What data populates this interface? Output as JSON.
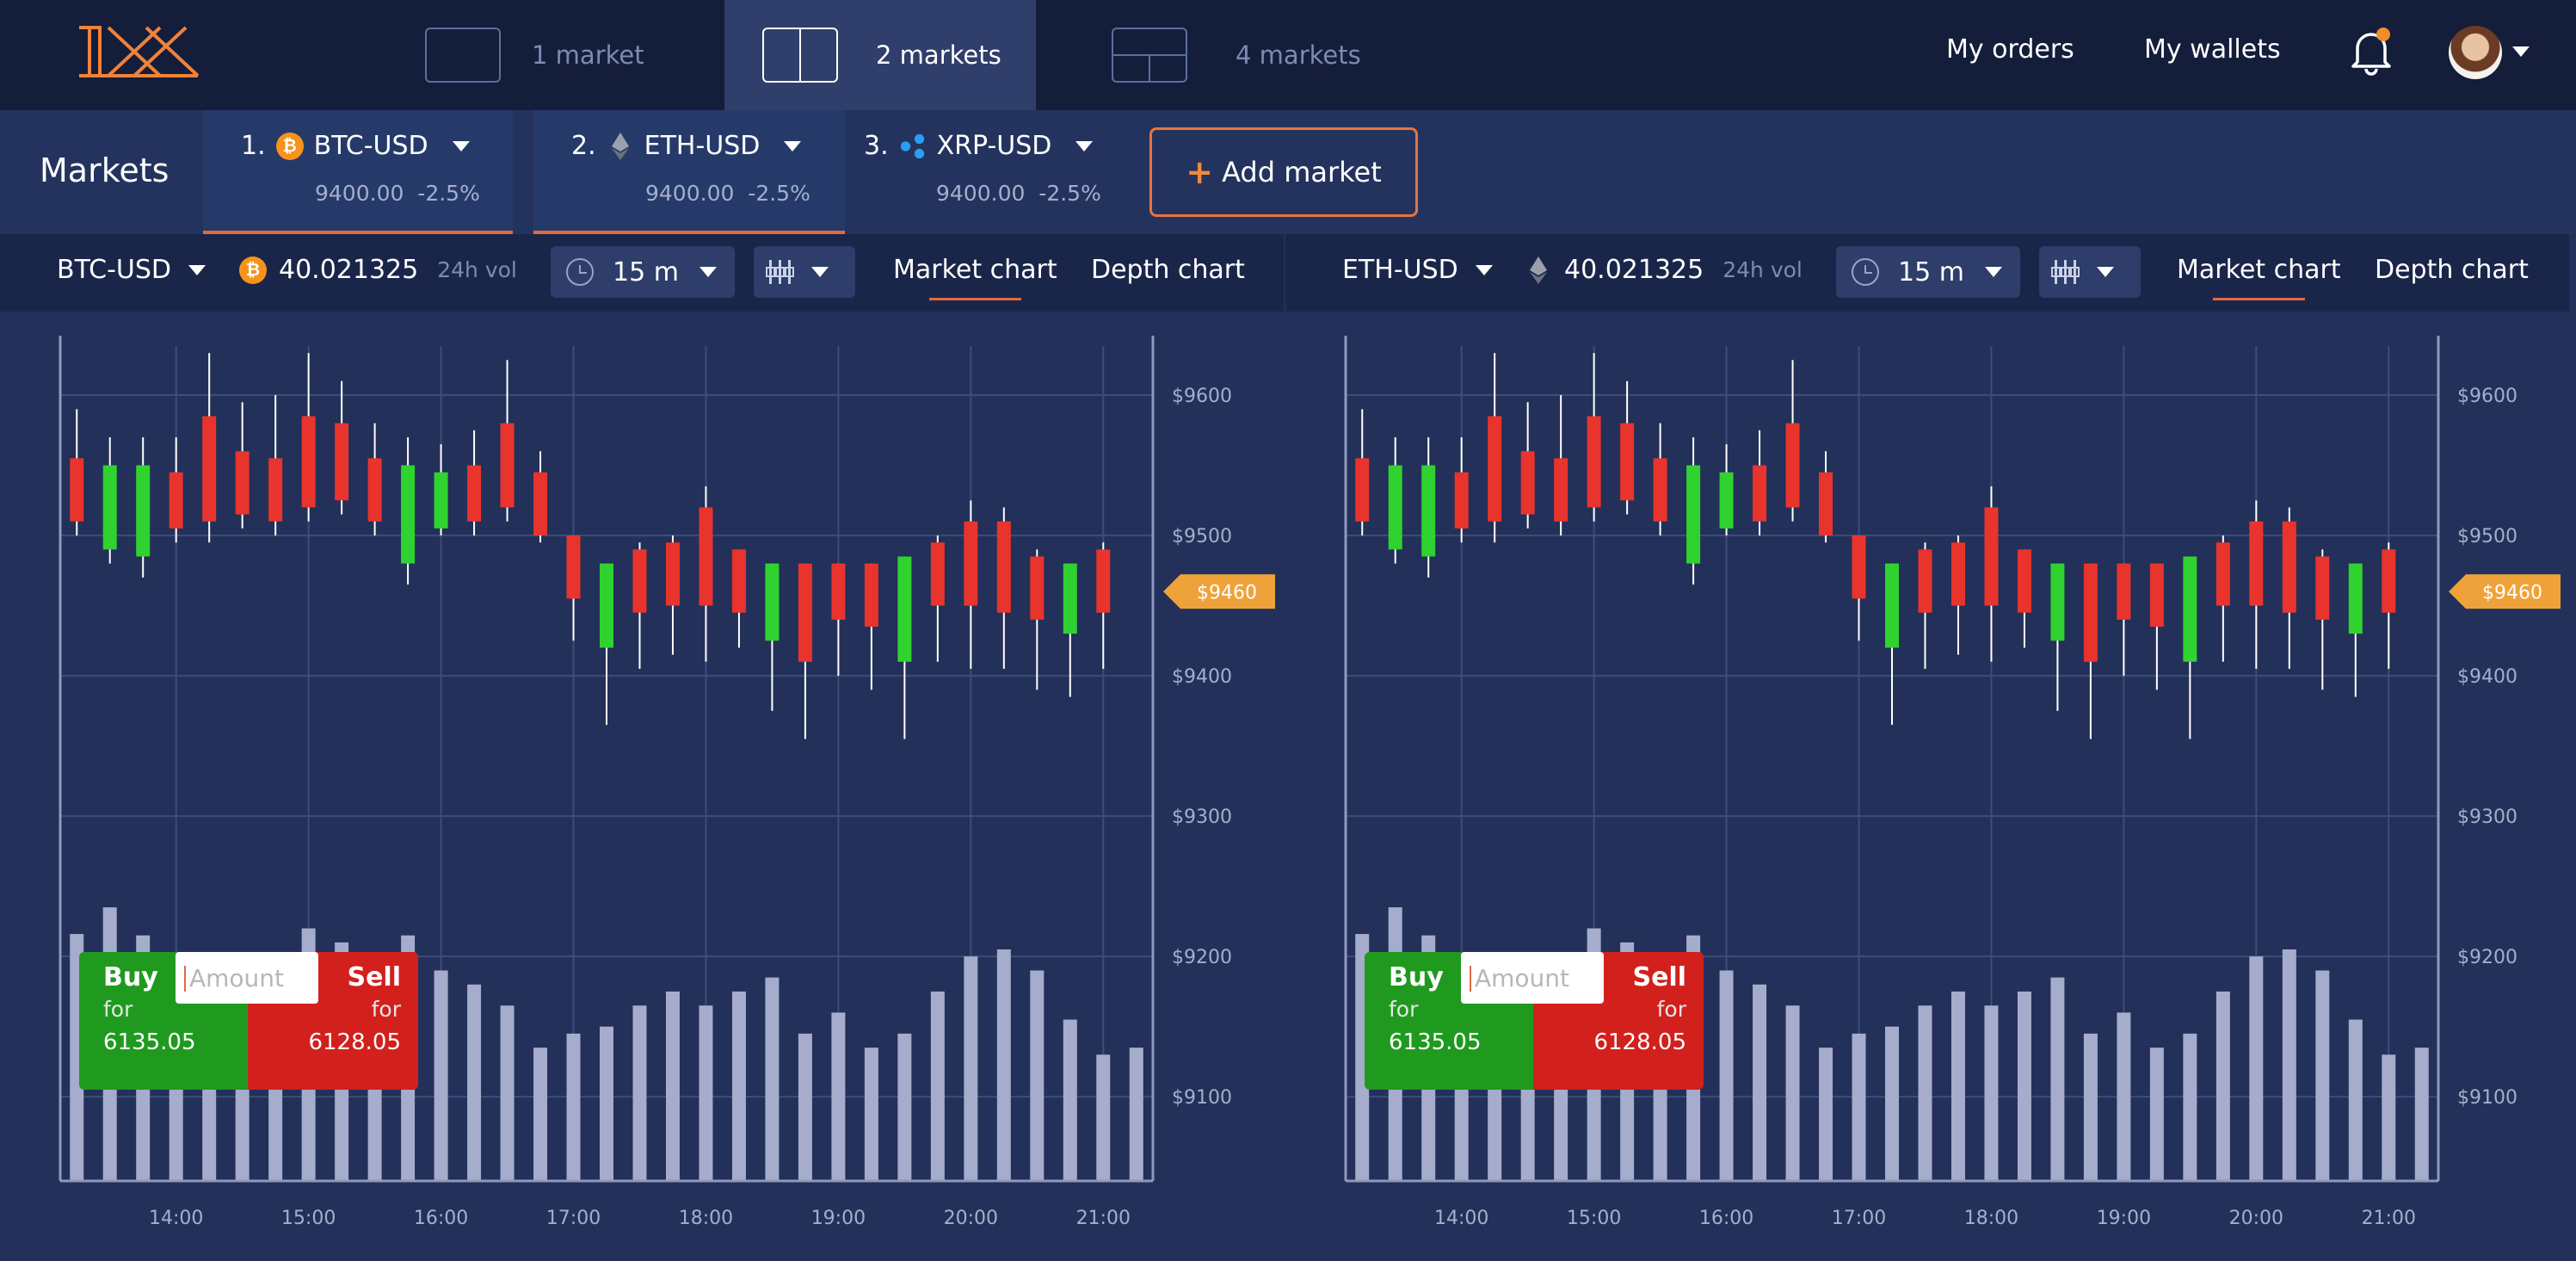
{
  "top_bar": {
    "logo_text": "1X",
    "layout_tabs": [
      {
        "label": "1 market",
        "active": false
      },
      {
        "label": "2 markets",
        "active": true
      },
      {
        "label": "4 markets",
        "active": false
      }
    ],
    "nav": {
      "my_orders": "My orders",
      "my_wallets": "My wallets"
    },
    "bell_icon": "bell-icon",
    "notification_color": "#f28d2c",
    "avatar_icon": "user-avatar"
  },
  "markets_bar": {
    "title": "Markets",
    "tabs": [
      {
        "index": "1.",
        "pair": "BTC-USD",
        "coin_icon": "bitcoin-icon",
        "coin_color": "#f7931a",
        "price": "9400.00",
        "change": "-2.5%",
        "active": true
      },
      {
        "index": "2.",
        "pair": "ETH-USD",
        "coin_icon": "ethereum-icon",
        "coin_color": "#8a8f99",
        "price": "9400.00",
        "change": "-2.5%",
        "active": true
      },
      {
        "index": "3.",
        "pair": "XRP-USD",
        "coin_icon": "ripple-icon",
        "coin_color": "#2a9df4",
        "price": "9400.00",
        "change": "-2.5%",
        "active": false
      }
    ],
    "add_market": {
      "icon": "+",
      "label": "Add market"
    }
  },
  "panels": [
    {
      "pair": "BTC-USD",
      "coin_icon": "bitcoin-icon",
      "coin_color": "#f7931a",
      "volume": "40.021325",
      "volume_unit": "24h vol",
      "interval": "15 m",
      "chart_type_icon": "candlestick-icon",
      "tabs": {
        "market_chart": "Market chart",
        "depth_chart": "Depth chart"
      },
      "trade": {
        "buy": "Buy",
        "sell": "Sell",
        "for": "for",
        "buy_price": "6135.05",
        "sell_price": "6128.05",
        "amount_placeholder": "Amount"
      }
    },
    {
      "pair": "ETH-USD",
      "coin_icon": "ethereum-icon",
      "coin_color": "#8a8f99",
      "volume": "40.021325",
      "volume_unit": "24h vol",
      "interval": "15 m",
      "chart_type_icon": "candlestick-icon",
      "tabs": {
        "market_chart": "Market chart",
        "depth_chart": "Depth chart"
      },
      "trade": {
        "buy": "Buy",
        "sell": "Sell",
        "for": "for",
        "buy_price": "6135.05",
        "sell_price": "6128.05",
        "amount_placeholder": "Amount"
      }
    }
  ],
  "colors": {
    "up": "#2fd22f",
    "down": "#e8342c",
    "price_tag": "#f0a23a",
    "accent": "#e06a40"
  },
  "chart_data": [
    {
      "type": "candlestick",
      "ylim": [
        9040,
        9635
      ],
      "y_ticks": [
        "$9600",
        "$9500",
        "$9400",
        "$9300",
        "$9200",
        "$9100"
      ],
      "y_tick_values": [
        9600,
        9500,
        9400,
        9300,
        9200,
        9100
      ],
      "x_ticks": [
        "14:00",
        "15:00",
        "16:00",
        "17:00",
        "18:00",
        "19:00",
        "20:00",
        "21:00"
      ],
      "x_tick_slots": [
        3,
        7,
        11,
        15,
        19,
        23,
        27,
        31
      ],
      "current_price_label": "$9460",
      "current_price": 9460,
      "candles": [
        {
          "open": 9555,
          "close": 9510,
          "high": 9590,
          "low": 9500
        },
        {
          "open": 9490,
          "close": 9550,
          "high": 9570,
          "low": 9480
        },
        {
          "open": 9485,
          "close": 9550,
          "high": 9570,
          "low": 9470
        },
        {
          "open": 9545,
          "close": 9505,
          "high": 9570,
          "low": 9495
        },
        {
          "open": 9585,
          "close": 9510,
          "high": 9630,
          "low": 9495
        },
        {
          "open": 9560,
          "close": 9515,
          "high": 9595,
          "low": 9505
        },
        {
          "open": 9555,
          "close": 9510,
          "high": 9600,
          "low": 9500
        },
        {
          "open": 9585,
          "close": 9520,
          "high": 9630,
          "low": 9510
        },
        {
          "open": 9580,
          "close": 9525,
          "high": 9610,
          "low": 9515
        },
        {
          "open": 9555,
          "close": 9510,
          "high": 9580,
          "low": 9500
        },
        {
          "open": 9480,
          "close": 9550,
          "high": 9570,
          "low": 9465
        },
        {
          "open": 9505,
          "close": 9545,
          "high": 9565,
          "low": 9500
        },
        {
          "open": 9550,
          "close": 9510,
          "high": 9575,
          "low": 9500
        },
        {
          "open": 9580,
          "close": 9520,
          "high": 9625,
          "low": 9510
        },
        {
          "open": 9545,
          "close": 9500,
          "high": 9560,
          "low": 9495
        },
        {
          "open": 9500,
          "close": 9455,
          "high": 9500,
          "low": 9425
        },
        {
          "open": 9420,
          "close": 9480,
          "high": 9480,
          "low": 9365
        },
        {
          "open": 9490,
          "close": 9445,
          "high": 9495,
          "low": 9405
        },
        {
          "open": 9495,
          "close": 9450,
          "high": 9500,
          "low": 9415
        },
        {
          "open": 9520,
          "close": 9450,
          "high": 9535,
          "low": 9410
        },
        {
          "open": 9490,
          "close": 9445,
          "high": 9490,
          "low": 9420
        },
        {
          "open": 9425,
          "close": 9480,
          "high": 9480,
          "low": 9375
        },
        {
          "open": 9480,
          "close": 9410,
          "high": 9480,
          "low": 9355
        },
        {
          "open": 9480,
          "close": 9440,
          "high": 9480,
          "low": 9400
        },
        {
          "open": 9480,
          "close": 9435,
          "high": 9480,
          "low": 9390
        },
        {
          "open": 9410,
          "close": 9485,
          "high": 9485,
          "low": 9355
        },
        {
          "open": 9495,
          "close": 9450,
          "high": 9500,
          "low": 9410
        },
        {
          "open": 9510,
          "close": 9450,
          "high": 9525,
          "low": 9405
        },
        {
          "open": 9510,
          "close": 9445,
          "high": 9520,
          "low": 9405
        },
        {
          "open": 9485,
          "close": 9440,
          "high": 9490,
          "low": 9390
        },
        {
          "open": 9430,
          "close": 9480,
          "high": 9480,
          "low": 9385
        },
        {
          "open": 9490,
          "close": 9445,
          "high": 9495,
          "low": 9405
        }
      ],
      "volumes": [
        9216,
        9235,
        9215,
        9175,
        9160,
        9170,
        9175,
        9220,
        9210,
        9200,
        9215,
        9190,
        9180,
        9165,
        9135,
        9145,
        9150,
        9165,
        9175,
        9165,
        9175,
        9185,
        9145,
        9160,
        9135,
        9145,
        9175,
        9200,
        9205,
        9190,
        9155,
        9130,
        9135
      ]
    },
    {
      "type": "candlestick",
      "ylim": [
        9040,
        9635
      ],
      "y_ticks": [
        "$9600",
        "$9500",
        "$9400",
        "$9300",
        "$9200",
        "$9100"
      ],
      "y_tick_values": [
        9600,
        9500,
        9400,
        9300,
        9200,
        9100
      ],
      "x_ticks": [
        "14:00",
        "15:00",
        "16:00",
        "17:00",
        "18:00",
        "19:00",
        "20:00",
        "21:00"
      ],
      "x_tick_slots": [
        3,
        7,
        11,
        15,
        19,
        23,
        27,
        31
      ],
      "current_price_label": "$9460",
      "current_price": 9460,
      "candles": [
        {
          "open": 9555,
          "close": 9510,
          "high": 9590,
          "low": 9500
        },
        {
          "open": 9490,
          "close": 9550,
          "high": 9570,
          "low": 9480
        },
        {
          "open": 9485,
          "close": 9550,
          "high": 9570,
          "low": 9470
        },
        {
          "open": 9545,
          "close": 9505,
          "high": 9570,
          "low": 9495
        },
        {
          "open": 9585,
          "close": 9510,
          "high": 9630,
          "low": 9495
        },
        {
          "open": 9560,
          "close": 9515,
          "high": 9595,
          "low": 9505
        },
        {
          "open": 9555,
          "close": 9510,
          "high": 9600,
          "low": 9500
        },
        {
          "open": 9585,
          "close": 9520,
          "high": 9630,
          "low": 9510
        },
        {
          "open": 9580,
          "close": 9525,
          "high": 9610,
          "low": 9515
        },
        {
          "open": 9555,
          "close": 9510,
          "high": 9580,
          "low": 9500
        },
        {
          "open": 9480,
          "close": 9550,
          "high": 9570,
          "low": 9465
        },
        {
          "open": 9505,
          "close": 9545,
          "high": 9565,
          "low": 9500
        },
        {
          "open": 9550,
          "close": 9510,
          "high": 9575,
          "low": 9500
        },
        {
          "open": 9580,
          "close": 9520,
          "high": 9625,
          "low": 9510
        },
        {
          "open": 9545,
          "close": 9500,
          "high": 9560,
          "low": 9495
        },
        {
          "open": 9500,
          "close": 9455,
          "high": 9500,
          "low": 9425
        },
        {
          "open": 9420,
          "close": 9480,
          "high": 9480,
          "low": 9365
        },
        {
          "open": 9490,
          "close": 9445,
          "high": 9495,
          "low": 9405
        },
        {
          "open": 9495,
          "close": 9450,
          "high": 9500,
          "low": 9415
        },
        {
          "open": 9520,
          "close": 9450,
          "high": 9535,
          "low": 9410
        },
        {
          "open": 9490,
          "close": 9445,
          "high": 9490,
          "low": 9420
        },
        {
          "open": 9425,
          "close": 9480,
          "high": 9480,
          "low": 9375
        },
        {
          "open": 9480,
          "close": 9410,
          "high": 9480,
          "low": 9355
        },
        {
          "open": 9480,
          "close": 9440,
          "high": 9480,
          "low": 9400
        },
        {
          "open": 9480,
          "close": 9435,
          "high": 9480,
          "low": 9390
        },
        {
          "open": 9410,
          "close": 9485,
          "high": 9485,
          "low": 9355
        },
        {
          "open": 9495,
          "close": 9450,
          "high": 9500,
          "low": 9410
        },
        {
          "open": 9510,
          "close": 9450,
          "high": 9525,
          "low": 9405
        },
        {
          "open": 9510,
          "close": 9445,
          "high": 9520,
          "low": 9405
        },
        {
          "open": 9485,
          "close": 9440,
          "high": 9490,
          "low": 9390
        },
        {
          "open": 9430,
          "close": 9480,
          "high": 9480,
          "low": 9385
        },
        {
          "open": 9490,
          "close": 9445,
          "high": 9495,
          "low": 9405
        }
      ],
      "volumes": [
        9216,
        9235,
        9215,
        9175,
        9160,
        9170,
        9175,
        9220,
        9210,
        9200,
        9215,
        9190,
        9180,
        9165,
        9135,
        9145,
        9150,
        9165,
        9175,
        9165,
        9175,
        9185,
        9145,
        9160,
        9135,
        9145,
        9175,
        9200,
        9205,
        9190,
        9155,
        9130,
        9135
      ]
    }
  ]
}
